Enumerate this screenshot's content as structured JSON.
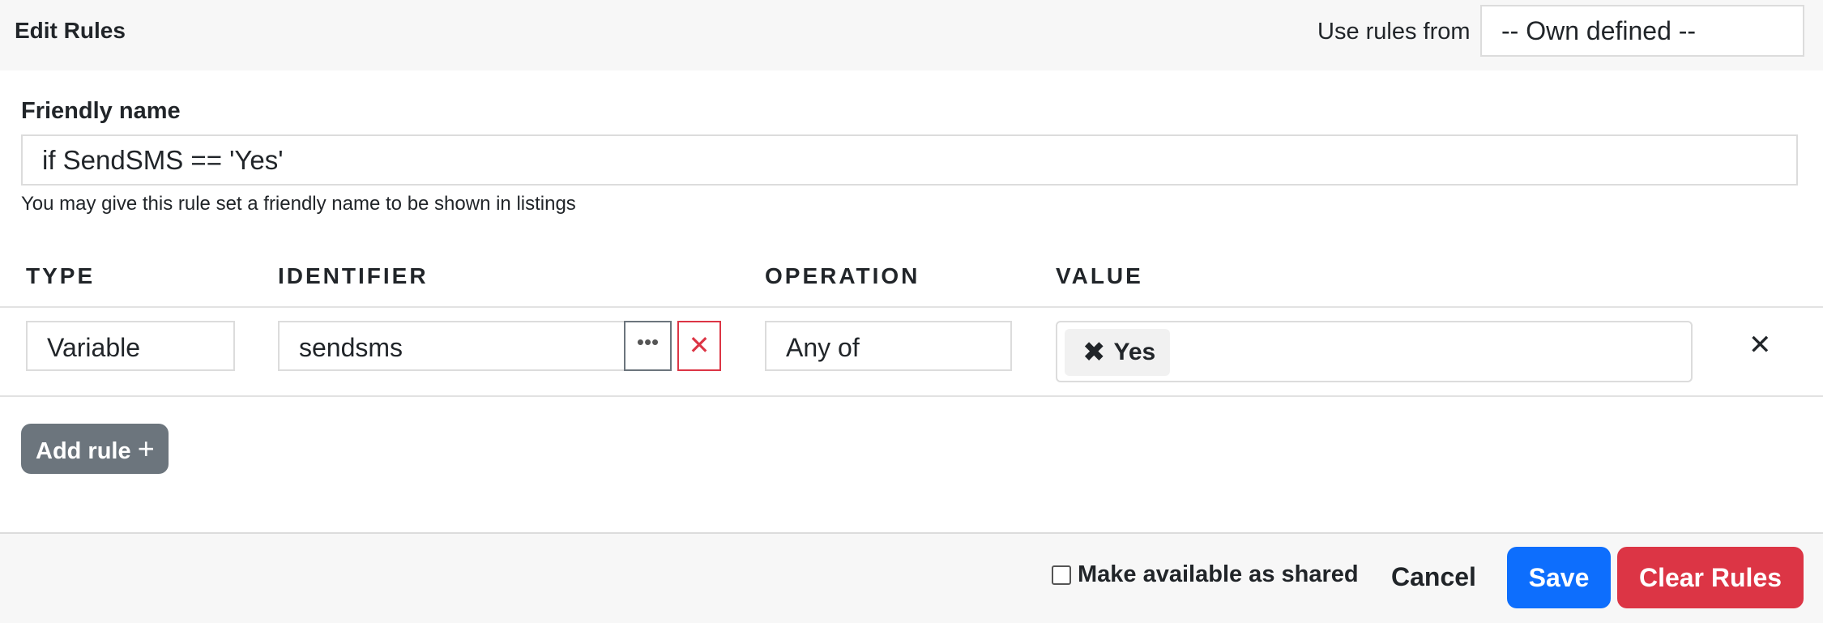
{
  "header": {
    "title": "Edit Rules",
    "use_rules_label": "Use rules from",
    "use_rules_value": "-- Own defined --"
  },
  "friendly": {
    "label": "Friendly name",
    "value": "if SendSMS == 'Yes'",
    "help": "You may give this rule set a friendly name to be shown in listings"
  },
  "columns": {
    "type": "TYPE",
    "identifier": "IDENTIFIER",
    "operation": "OPERATION",
    "value": "VALUE"
  },
  "rules": [
    {
      "type": "Variable",
      "identifier": "sendsms",
      "operation": "Any of",
      "values": [
        "Yes"
      ]
    }
  ],
  "icons": {
    "more": "ellipsis-icon",
    "clear": "close-icon",
    "chip_remove": "close-icon",
    "row_remove": "close-icon",
    "add": "plus-icon"
  },
  "actions": {
    "add_rule": "Add rule",
    "shared_label": "Make available as shared",
    "shared_checked": false,
    "cancel": "Cancel",
    "save": "Save",
    "clear_rules": "Clear Rules"
  },
  "colors": {
    "primary": "#0d6efd",
    "danger": "#dc3545",
    "secondary": "#6c757d"
  }
}
